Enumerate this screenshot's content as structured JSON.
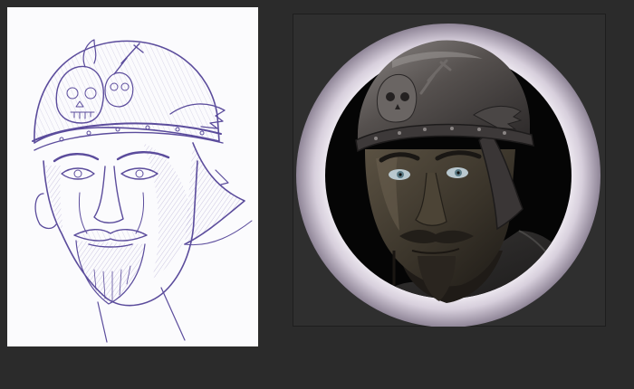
{
  "canvas": {
    "background": "#2b2b2b"
  },
  "sketch": {
    "paper_color": "#fbfbfd",
    "ink_color": "#5a4a9a"
  },
  "painting": {
    "ring_color": "#d9d3dd",
    "backdrop_color": "#050505",
    "helmet_color": "#4f4b4a",
    "skin_color": "#3f3a30"
  }
}
